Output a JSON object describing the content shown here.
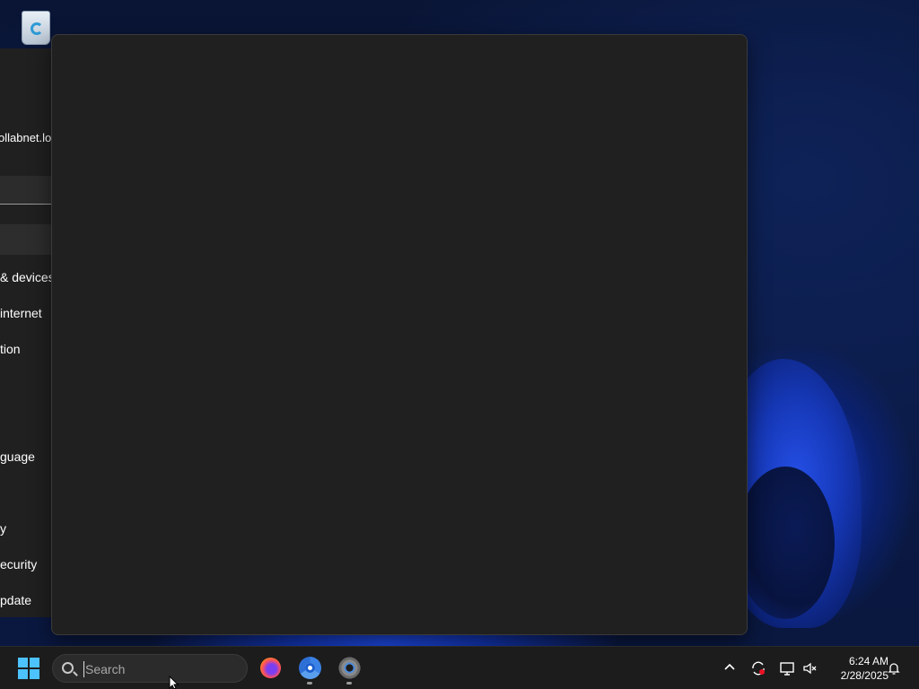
{
  "desktop": {
    "icons": [
      {
        "name": "recycle-bin-icon"
      }
    ]
  },
  "settings_window": {
    "account_text": "ollabnet.lo",
    "nav_items": [
      {
        "label": "& devices"
      },
      {
        "label": "internet"
      },
      {
        "label": "tion"
      },
      {
        "label": "guage"
      },
      {
        "label": "y"
      },
      {
        "label": "ecurity"
      },
      {
        "label": "pdate"
      }
    ]
  },
  "taskbar": {
    "search_placeholder": "Search",
    "apps": [
      {
        "name": "firefox-icon"
      },
      {
        "name": "chrome-icon"
      },
      {
        "name": "settings-gear-icon"
      }
    ],
    "tray": {
      "chevron": "^",
      "time": "6:24 AM",
      "date": "2/28/2025"
    }
  },
  "colors": {
    "start_accent": "#4cc2ff",
    "window_bg": "#202020",
    "taskbar_bg": "#1c1c1c"
  }
}
